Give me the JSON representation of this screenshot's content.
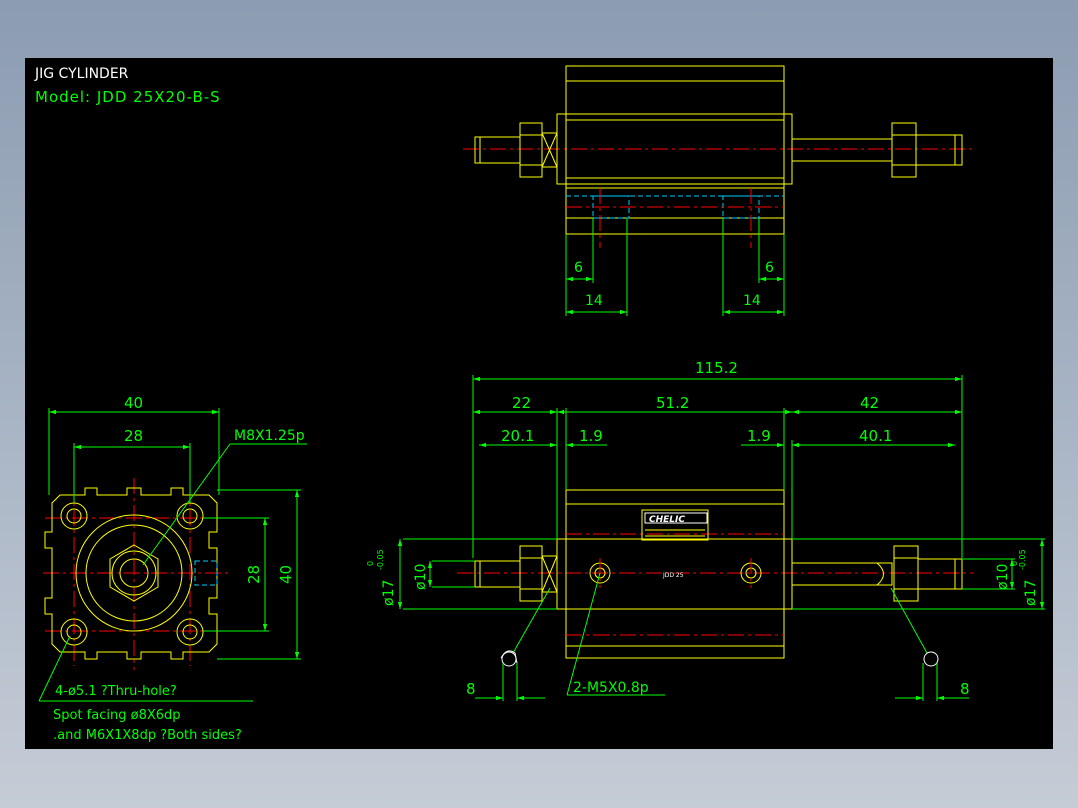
{
  "title": "JIG CYLINDER",
  "model": "Model: JDD 25X20-B-S",
  "colors": {
    "background": "#000000",
    "outline": "#ffff00",
    "dimension": "#00ff00",
    "centerline": "#ff0000",
    "hidden": "#00ccff",
    "text_white": "#ffffff"
  },
  "top_view": {
    "dims": {
      "left_6": "6",
      "right_6": "6",
      "left_14": "14",
      "right_14": "14"
    }
  },
  "front_view": {
    "dims": {
      "overall": "115.2",
      "left": "22",
      "middle": "51.2",
      "right": "42",
      "left_inner": "20.1",
      "left_gap": "1.9",
      "right_gap": "1.9",
      "right_inner": "40.1",
      "left_tip": "8",
      "right_tip": "8"
    },
    "diameters": {
      "left_rod": "ø10",
      "right_rod": "ø10",
      "left_boss": "ø17",
      "right_boss": "ø17",
      "left_tol_upper": "0",
      "left_tol_lower": "-0.05",
      "right_tol_upper": "0",
      "right_tol_lower": "-0.05"
    },
    "port_note": "2-M5X0.8p",
    "label_brand": "CHELIC",
    "label_small": "JDD 25"
  },
  "side_view": {
    "dims": {
      "width": "40",
      "hole_pitch": "28",
      "height": "40",
      "hole_pitch_v": "28"
    },
    "thread_note": "M8X1.25p",
    "notes": [
      "4-ø5.1 ?Thru-hole?",
      "Spot facing  ø8X6dp",
      ".and M6X1X8dp ?Both sides?"
    ]
  }
}
